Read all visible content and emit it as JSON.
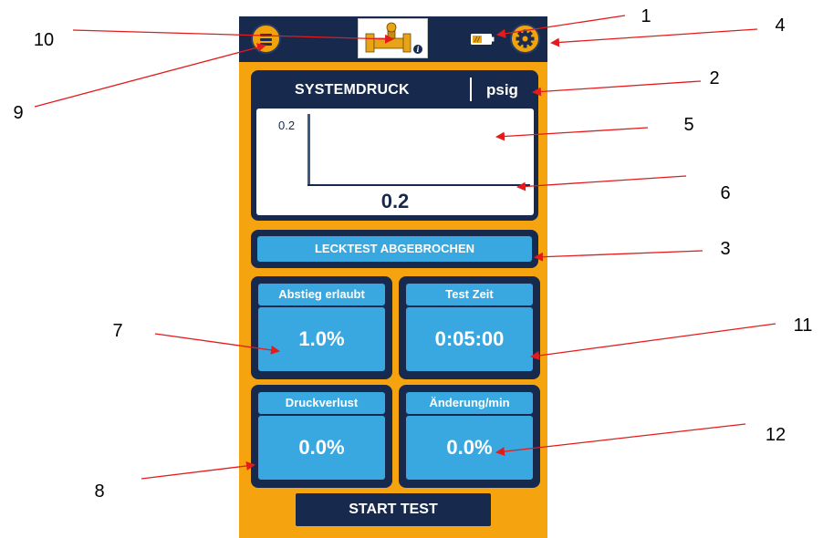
{
  "app": {
    "menu_icon": "hamburger-menu-icon",
    "device_icon": "pipe-valve-info-icon",
    "battery_icon": "battery-low-icon",
    "settings_icon": "gear-icon"
  },
  "pressure": {
    "title": "SYSTEMDRUCK",
    "unit": "psig",
    "y_tick": "0.2",
    "value": "0.2"
  },
  "status": {
    "text": "LECKTEST ABGEBROCHEN"
  },
  "tiles": {
    "decline": {
      "label": "Abstieg erlaubt",
      "value": "1.0%"
    },
    "test_time": {
      "label": "Test Zeit",
      "value": "0:05:00"
    },
    "pressure_loss": {
      "label": "Druckverlust",
      "value": "0.0%"
    },
    "change_per_min": {
      "label": "Änderung/min",
      "value": "0.0%"
    }
  },
  "start_button": {
    "label": "START TEST"
  },
  "callouts": [
    "1",
    "2",
    "3",
    "4",
    "5",
    "6",
    "7",
    "8",
    "9",
    "10",
    "11",
    "12"
  ],
  "colors": {
    "navy": "#172a4e",
    "orange": "#f5a40f",
    "light_blue": "#3aa8e0",
    "arrow_red": "#e31b1b"
  }
}
